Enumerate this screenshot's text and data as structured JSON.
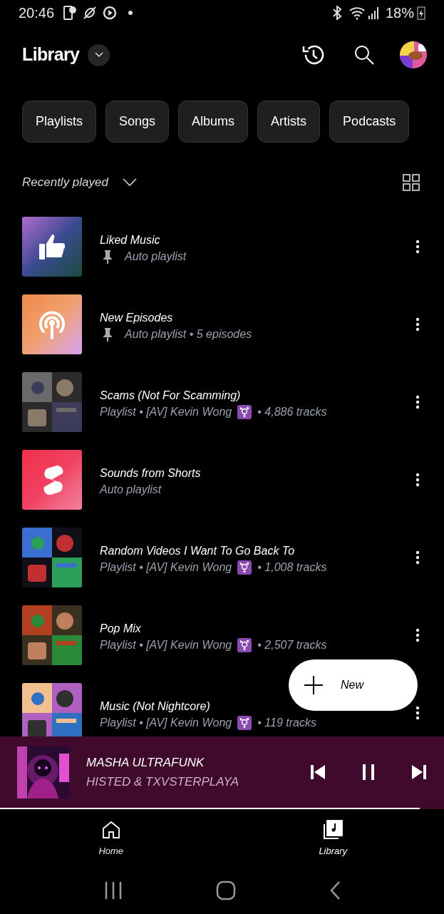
{
  "status_bar": {
    "time": "20:46",
    "battery": "18%"
  },
  "header": {
    "title": "Library"
  },
  "chips": [
    {
      "label": "Playlists"
    },
    {
      "label": "Songs"
    },
    {
      "label": "Albums"
    },
    {
      "label": "Artists"
    },
    {
      "label": "Podcasts"
    }
  ],
  "sort": {
    "label": "Recently played"
  },
  "items": [
    {
      "title": "Liked Music",
      "kind": "liked",
      "pinned": true,
      "subtitle": "Auto playlist",
      "emoji_badge": false
    },
    {
      "title": "New Episodes",
      "kind": "podcast",
      "pinned": true,
      "subtitle": "Auto playlist • 5 episodes",
      "emoji_badge": false
    },
    {
      "title": "Scams (Not For Scamming)",
      "kind": "picture",
      "pinned": false,
      "subtitle": "Playlist • [AV] Kevin Wong",
      "emoji_badge": true,
      "subtitle_after": "• 4,886 tracks"
    },
    {
      "title": "Sounds from Shorts",
      "kind": "shorts",
      "pinned": false,
      "subtitle": "Auto playlist",
      "emoji_badge": false
    },
    {
      "title": "Random Videos I Want To Go Back To",
      "kind": "picture",
      "pinned": false,
      "subtitle": "Playlist • [AV] Kevin Wong",
      "emoji_badge": true,
      "subtitle_after": "• 1,008 tracks"
    },
    {
      "title": "Pop Mix",
      "kind": "picture",
      "pinned": false,
      "subtitle": "Playlist • [AV] Kevin Wong",
      "emoji_badge": true,
      "subtitle_after": "• 2,507 tracks"
    },
    {
      "title": "Music (Not Nightcore)",
      "kind": "picture",
      "pinned": false,
      "subtitle": "Playlist • [AV] Kevin Wong",
      "emoji_badge": true,
      "subtitle_after": "• 119 tracks"
    }
  ],
  "fab": {
    "label": "New"
  },
  "player": {
    "title": "MASHA ULTRAFUNK",
    "artist": "HISTED & TXVSTERPLAYA",
    "level": 0.945
  },
  "nav": [
    {
      "label": "Home",
      "selected": false
    },
    {
      "label": "Library",
      "selected": true
    }
  ]
}
